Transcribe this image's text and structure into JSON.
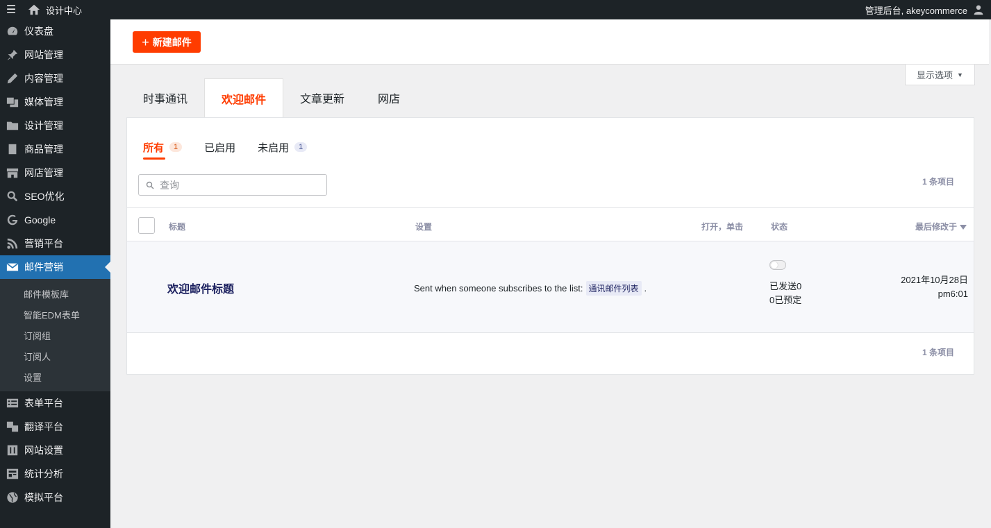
{
  "topbar": {
    "site_name": "设计中心",
    "account": "管理后台, akeycommerce"
  },
  "sidebar": {
    "items": [
      {
        "label": "仪表盘",
        "icon": "dashboard-icon"
      },
      {
        "label": "网站管理",
        "icon": "pin-icon"
      },
      {
        "label": "内容管理",
        "icon": "pencil-icon"
      },
      {
        "label": "媒体管理",
        "icon": "media-icon"
      },
      {
        "label": "设计管理",
        "icon": "folder-icon"
      },
      {
        "label": "商品管理",
        "icon": "book-icon"
      },
      {
        "label": "网店管理",
        "icon": "store-icon"
      },
      {
        "label": "SEO优化",
        "icon": "search-icon"
      },
      {
        "label": "Google",
        "icon": "google-icon"
      },
      {
        "label": "营销平台",
        "icon": "rss-icon"
      },
      {
        "label": "邮件营销",
        "icon": "mail-icon",
        "active": true
      }
    ],
    "submenu": [
      "邮件模板库",
      "智能EDM表单",
      "订阅组",
      "订阅人",
      "设置"
    ],
    "items_after": [
      {
        "label": "表单平台",
        "icon": "form-icon"
      },
      {
        "label": "翻译平台",
        "icon": "translate-icon"
      },
      {
        "label": "网站设置",
        "icon": "settings-icon"
      },
      {
        "label": "统计分析",
        "icon": "analytics-icon"
      },
      {
        "label": "模拟平台",
        "icon": "globe-icon"
      }
    ]
  },
  "header": {
    "new_button": "新建邮件",
    "screen_options": "显示选项"
  },
  "tabs": [
    "时事通讯",
    "欢迎邮件",
    "文章更新",
    "网店"
  ],
  "subtabs": [
    {
      "label": "所有",
      "count": "1"
    },
    {
      "label": "已启用"
    },
    {
      "label": "未启用",
      "count": "1"
    }
  ],
  "search": {
    "placeholder": "查询"
  },
  "items_count": "1 条项目",
  "table": {
    "headers": {
      "title": "标题",
      "settings": "设置",
      "opens": "打开，单击",
      "status": "状态",
      "modified": "最后修改于"
    },
    "rows": [
      {
        "title": "欢迎邮件标题",
        "setting_text": "Sent when someone subscribes to the list:",
        "list_name": "通讯邮件列表",
        "setting_end": ".",
        "status_sent": "已发送0",
        "status_scheduled": "0已预定",
        "modified_date": "2021年10月28日",
        "modified_time": "pm6:01"
      }
    ]
  },
  "colors": {
    "accent": "#ff3c00",
    "sidebar_bg": "#1d2327",
    "active_nav": "#2271b1"
  }
}
